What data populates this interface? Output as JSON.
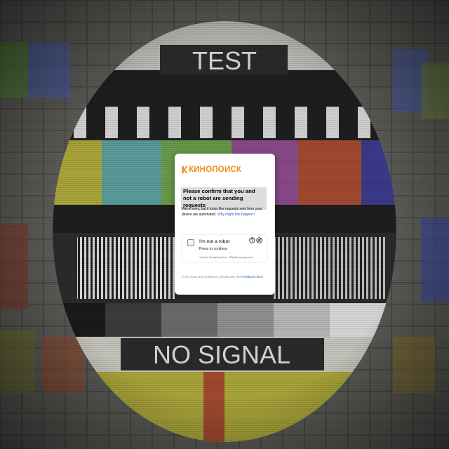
{
  "tv_background": {
    "top_label": "TEST",
    "bottom_label": "NO SIGNAL"
  },
  "captcha": {
    "logo_text": "КИНОПОИСК",
    "heading": "Please confirm that you and not a robot are sending requests",
    "description": "We're sorry, but it looks like requests sent from your device are automated.",
    "why_link": "Why might this happen?",
    "widget": {
      "title": "I'm not a robot",
      "subtitle": "Press to continue",
      "footer": "Yandex SmartCaptcha · Обработка данных",
      "icons": [
        "help-icon",
        "audio-icon"
      ]
    },
    "feedback_prefix": "If you have any problems, please use the",
    "feedback_link": "Feedback form"
  },
  "colors": {
    "brand_orange": "#f08c1e",
    "link_blue": "#2557c7"
  }
}
